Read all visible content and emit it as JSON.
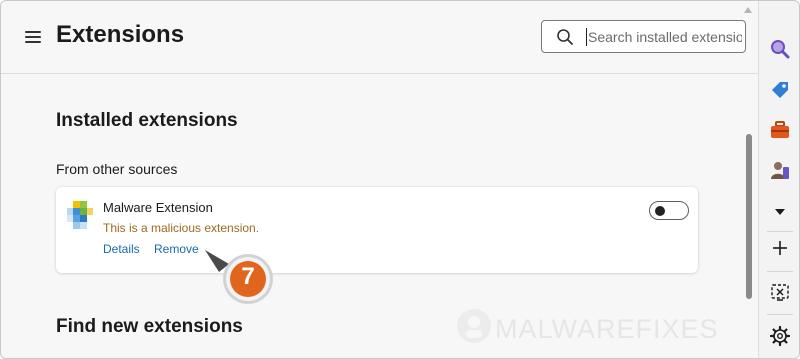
{
  "header": {
    "title": "Extensions",
    "search_placeholder": "Search installed extensions"
  },
  "sections": {
    "installed_title": "Installed extensions",
    "other_sources_label": "From other sources",
    "find_new_title": "Find new extensions"
  },
  "extension": {
    "name": "Malware Extension",
    "description": "This is a malicious extension.",
    "details_label": "Details",
    "remove_label": "Remove",
    "enabled": false
  },
  "annotation": {
    "step_number": "7"
  },
  "watermark": {
    "text": "MALWAREFIXES"
  },
  "sidebar": {
    "items": [
      "search-icon",
      "tag-icon",
      "toolbox-icon",
      "games-icon",
      "caret-down-icon",
      "plus-icon",
      "screenshot-icon",
      "gear-icon"
    ]
  },
  "colors": {
    "link": "#1a6ab0",
    "warning_text": "#9c6b1f",
    "badge_orange": "#e0661e",
    "background": "#f7f7f7"
  }
}
